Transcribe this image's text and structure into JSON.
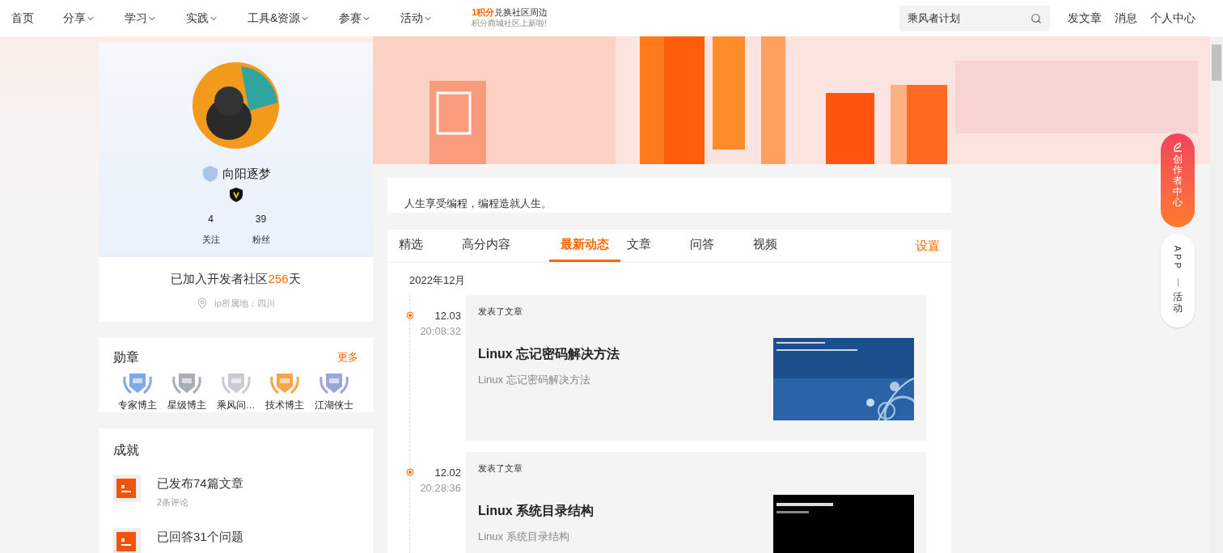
{
  "nav": {
    "items": [
      {
        "label": "首页",
        "dropdown": false
      },
      {
        "label": "分享",
        "dropdown": true
      },
      {
        "label": "学习",
        "dropdown": true
      },
      {
        "label": "实践",
        "dropdown": true
      },
      {
        "label": "工具&资源",
        "dropdown": true
      },
      {
        "label": "参赛",
        "dropdown": true
      },
      {
        "label": "活动",
        "dropdown": true
      }
    ],
    "promo": {
      "highlight": "1积分",
      "title": "兑换社区周边",
      "subtitle": "积分商城社区上新啦!"
    },
    "search": {
      "value": "乘风者计划"
    },
    "links": [
      "发文章",
      "消息",
      "个人中心"
    ]
  },
  "profile": {
    "name": "向阳逐梦",
    "stats": [
      {
        "value": "4",
        "label": "关注"
      },
      {
        "value": "39",
        "label": "粉丝"
      }
    ],
    "joined_prefix": "已加入开发者社区",
    "joined_days": "256",
    "joined_suffix": "天",
    "location": "ip所属地：四川"
  },
  "badges": {
    "title": "勋章",
    "more": "更多",
    "items": [
      {
        "label": "专家博主",
        "color": "#7fa8e6"
      },
      {
        "label": "星级博主",
        "color": "#a9adb5"
      },
      {
        "label": "乘风问…",
        "color": "#c8ccd2"
      },
      {
        "label": "技术博主",
        "color": "#f5a54a"
      },
      {
        "label": "江湖侠士",
        "color": "#9aa6d8"
      }
    ]
  },
  "achievements": {
    "title": "成就",
    "items": [
      {
        "title": "已发布74篇文章",
        "subtitle": "2条评论"
      },
      {
        "title": "已回答31个问题"
      }
    ]
  },
  "bio": "人生享受编程，编程造就人生。",
  "tabs": [
    {
      "label": "精选",
      "selected": false
    },
    {
      "label": "高分内容",
      "selected": false
    },
    {
      "label": "最新动态",
      "selected": true
    },
    {
      "label": "文章",
      "selected": false
    },
    {
      "label": "问答",
      "selected": false
    },
    {
      "label": "视频",
      "selected": false
    }
  ],
  "settings": "设置",
  "feed": {
    "month": "2022年12月",
    "entries": [
      {
        "date": "12.03",
        "time": "20:08:32",
        "action": "发表了文章",
        "title": "Linux 忘记密码解决方法",
        "summary": "Linux 忘记密码解决方法"
      },
      {
        "date": "12.02",
        "time": "20:28:36",
        "action": "发表了文章",
        "title": "Linux 系统目录结构",
        "summary": "Linux 系统目录结构"
      }
    ]
  },
  "float": {
    "creator": "创作者中心",
    "app": "APP",
    "activity": "活动"
  }
}
